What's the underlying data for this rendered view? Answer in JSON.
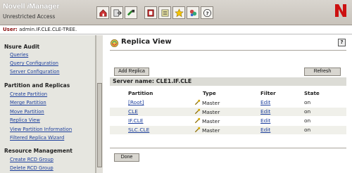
{
  "header": {
    "app_title_prefix": "Novell ",
    "app_title_italic": "i",
    "app_title_suffix": "Manager",
    "access_label": "Unrestricted Access"
  },
  "user": {
    "label": "User:",
    "value": "admin.IF.CLE.CLE-TREE."
  },
  "sidebar": {
    "sections": [
      {
        "title": "Nsure Audit",
        "items": [
          "Queries",
          "Query Configuration",
          "Server Configuration"
        ]
      },
      {
        "title": "Partition and Replicas",
        "items": [
          "Create Partition",
          "Merge Partition",
          "Move Partition",
          "Replica View",
          "View Partition Information",
          "Filtered Replica Wizard"
        ]
      },
      {
        "title": "Resource Management",
        "items": [
          "Create RCD Group",
          "Delete RCD Group"
        ]
      }
    ]
  },
  "main": {
    "title": "Replica View",
    "help": "?",
    "add_replica_label": "Add Replica",
    "refresh_label": "Refresh",
    "server_label": "Server name:",
    "server_value": "CLE1.IF.CLE",
    "columns": [
      "Partition",
      "Type",
      "Filter",
      "State"
    ],
    "rows": [
      {
        "partition": "[Root]",
        "type": "Master",
        "filter": "Edit",
        "state": "on"
      },
      {
        "partition": "CLE",
        "type": "Master",
        "filter": "Edit",
        "state": "on"
      },
      {
        "partition": "IF.CLE",
        "type": "Master",
        "filter": "Edit",
        "state": "on"
      },
      {
        "partition": "SLC.CLE",
        "type": "Master",
        "filter": "Edit",
        "state": "on"
      }
    ],
    "done_label": "Done"
  },
  "colors": {
    "link": "#1d3f9c",
    "brand_red": "#cc1111"
  }
}
